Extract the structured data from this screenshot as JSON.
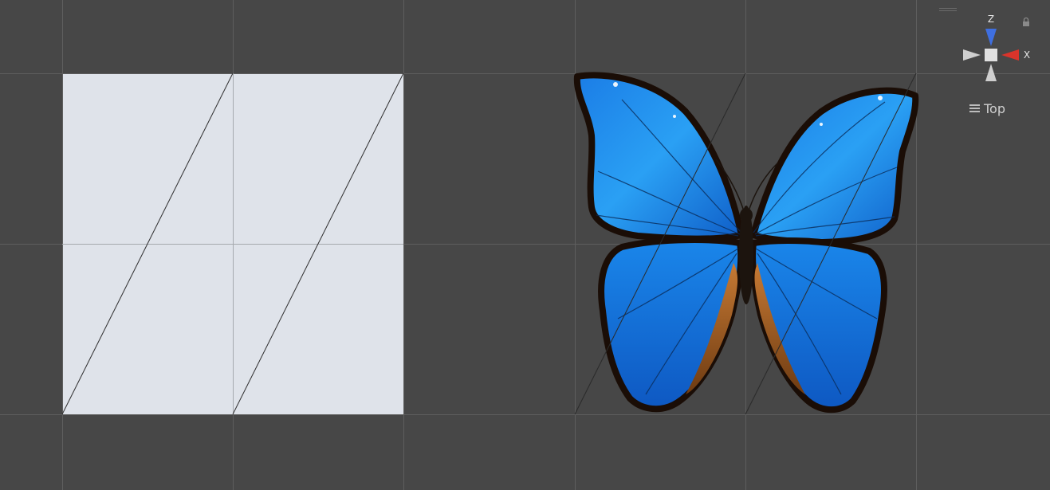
{
  "viewport": {
    "background_color": "#474747",
    "grid_color": "#5a5a5a",
    "quad_color": "#dfe3ea"
  },
  "orientation_gizmo": {
    "axis_z_label": "Z",
    "axis_x_label": "X",
    "colors": {
      "z": "#3f6fe0",
      "x": "#d9342b",
      "neutral": "#cfcfcf",
      "center": "#e0e0e0"
    }
  },
  "view_label": {
    "icon": "hamburger-menu-icon",
    "text": "Top"
  },
  "icons": {
    "lock": "lock-icon",
    "drag_handle": "drag-handle-icon"
  }
}
